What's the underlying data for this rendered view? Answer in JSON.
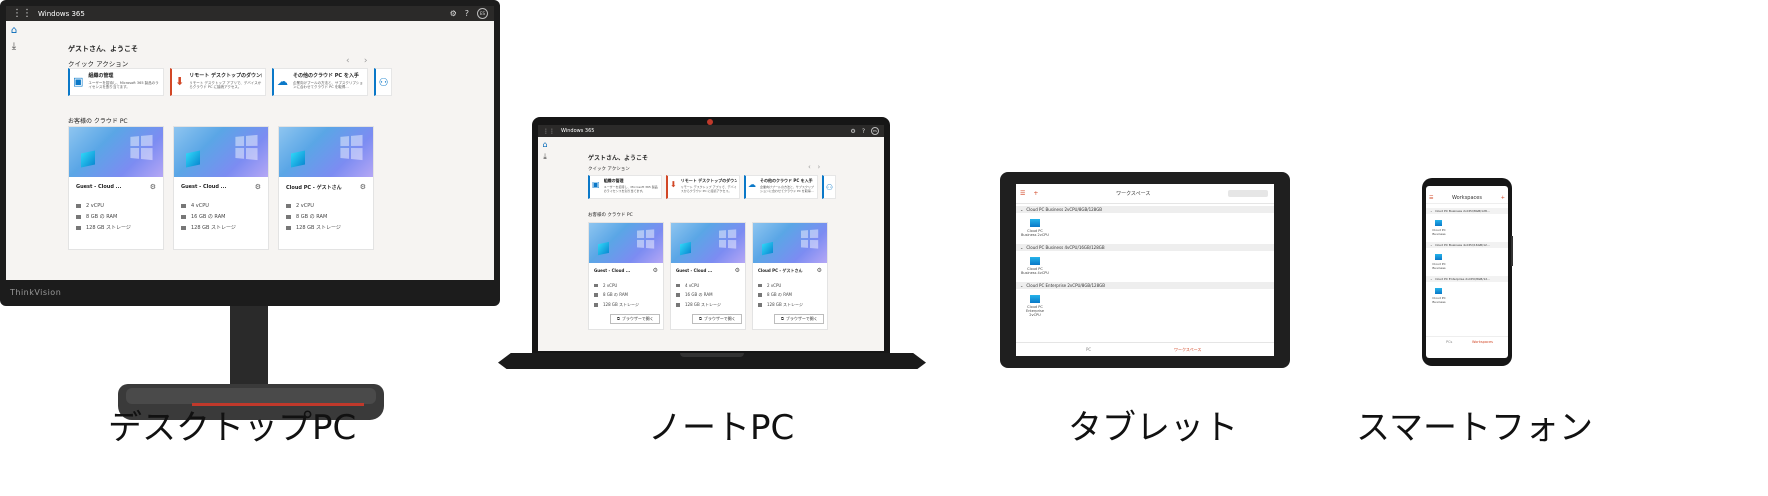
{
  "captions": {
    "desktop": "デスクトップPC",
    "laptop": "ノートPC",
    "tablet": "タブレット",
    "phone": "スマートフォン"
  },
  "monitor_brand": "ThinkVision",
  "win365": {
    "app_title": "Windows 365",
    "avatar_initials": "ES",
    "welcome": "ゲストさん、ようこそ",
    "quick_actions_title": "クイック アクション",
    "quick_actions": [
      {
        "title": "組織の管理",
        "desc": "ユーザーを招待し、Microsoft 365 製品のライセンスを割り当てます。",
        "icon": "manage-icon",
        "color": "#0a78c8"
      },
      {
        "title": "リモート デスクトップのダウンロード",
        "desc": "リモート デスクトップ アプリで、デバイスからクラウド PC に接続アクセス。",
        "icon": "download-icon",
        "color": "#d24726"
      },
      {
        "title": "その他のクラウド PC を入手",
        "desc": "企業向けプールの方法と、サブスクリプションに合わせてクラウド PC を取得…",
        "icon": "cloud-icon",
        "color": "#0a78c8"
      }
    ],
    "cloud_pcs_title": "お客様の クラウド PC",
    "open_in_browser": "ブラウザーで開く",
    "cloud_pcs": [
      {
        "name": "Guest - Cloud ...",
        "cpu": "2 vCPU",
        "ram": "8 GB の RAM",
        "storage": "128 GB ストレージ"
      },
      {
        "name": "Guest - Cloud ...",
        "cpu": "4 vCPU",
        "ram": "16 GB の RAM",
        "storage": "128 GB ストレージ"
      },
      {
        "name": "Cloud PC - ゲストさん",
        "cpu": "2 vCPU",
        "ram": "8 GB の RAM",
        "storage": "128 GB ストレージ"
      }
    ]
  },
  "tablet": {
    "header_title": "ワークスペース",
    "groups": [
      {
        "title": "Cloud PC Business 2vCPU/8GB/128GB",
        "pc_label": "Cloud PC Business 2vCPU"
      },
      {
        "title": "Cloud PC Business 4vCPU/16GB/128GB",
        "pc_label": "Cloud PC Business 4vCPU"
      },
      {
        "title": "Cloud PC Enterprise 2vCPU/8GB/128GB",
        "pc_label": "Cloud PC Enterprise 2vCPU"
      }
    ],
    "footer_left": "PC",
    "footer_right": "ワークスペース"
  },
  "phone": {
    "header_title": "Workspaces",
    "groups": [
      {
        "title": "Cloud PC Business 2vCPU/8GB/128...",
        "pc_label": "Cloud PC Business"
      },
      {
        "title": "Cloud PC Business 4vCPU/16GB/12...",
        "pc_label": "Cloud PC Business"
      },
      {
        "title": "Cloud PC Enterprise 2vCPU/8GB/12...",
        "pc_label": "Cloud PC Business"
      }
    ],
    "footer_left": "PCs",
    "footer_right": "Workspaces"
  },
  "colors": {
    "accent": "#0a78c8",
    "orange": "#d24726",
    "titlebar": "#2b2a29",
    "screen_bg": "#f6f4f2"
  }
}
